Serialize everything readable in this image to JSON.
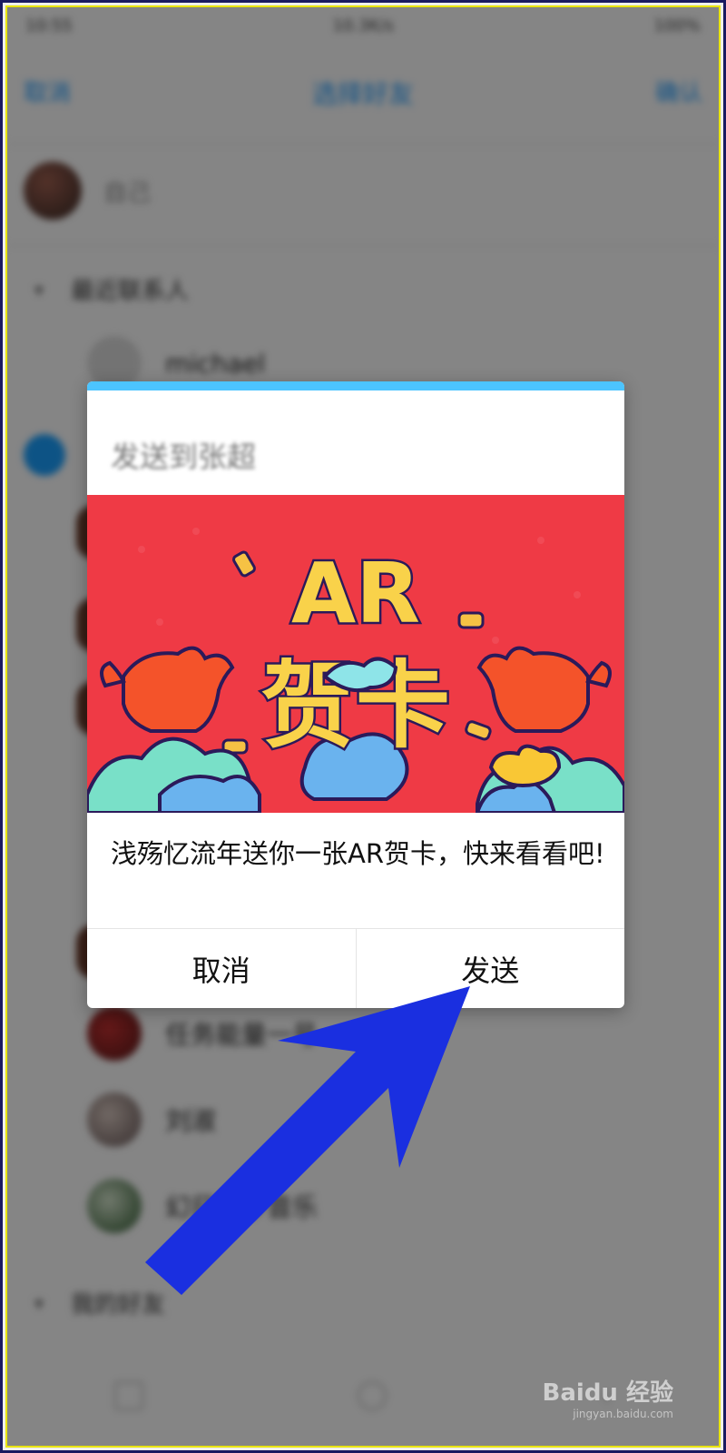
{
  "status_bar": {
    "time": "10:55",
    "speed": "10.3K/s",
    "battery": "100%"
  },
  "navbar": {
    "back_label": "取消",
    "title": "选择好友",
    "right_label": "确认"
  },
  "me_row": {
    "label": "自己"
  },
  "sections": {
    "recent": "最近联系人",
    "friends": "我的好友"
  },
  "contacts": [
    {
      "name": "michael"
    },
    {
      "name": "任务能量一号"
    },
    {
      "name": "刘淑"
    },
    {
      "name": "幻日潮汐音乐"
    }
  ],
  "dialog": {
    "title": "发送到张超",
    "message": "浅殇忆流年送你一张AR贺卡，快来看看吧!",
    "cancel_label": "取消",
    "send_label": "发送",
    "card": {
      "ar_text": "AR",
      "greeting_text": "贺卡"
    }
  },
  "watermark": {
    "brand": "Baidu 经验",
    "url": "jingyan.baidu.com"
  },
  "colors": {
    "accent": "#1d9bff",
    "card_bg": "#ef3a45",
    "arrow": "#1a2fe0",
    "frame_inner": "#e8e400"
  }
}
